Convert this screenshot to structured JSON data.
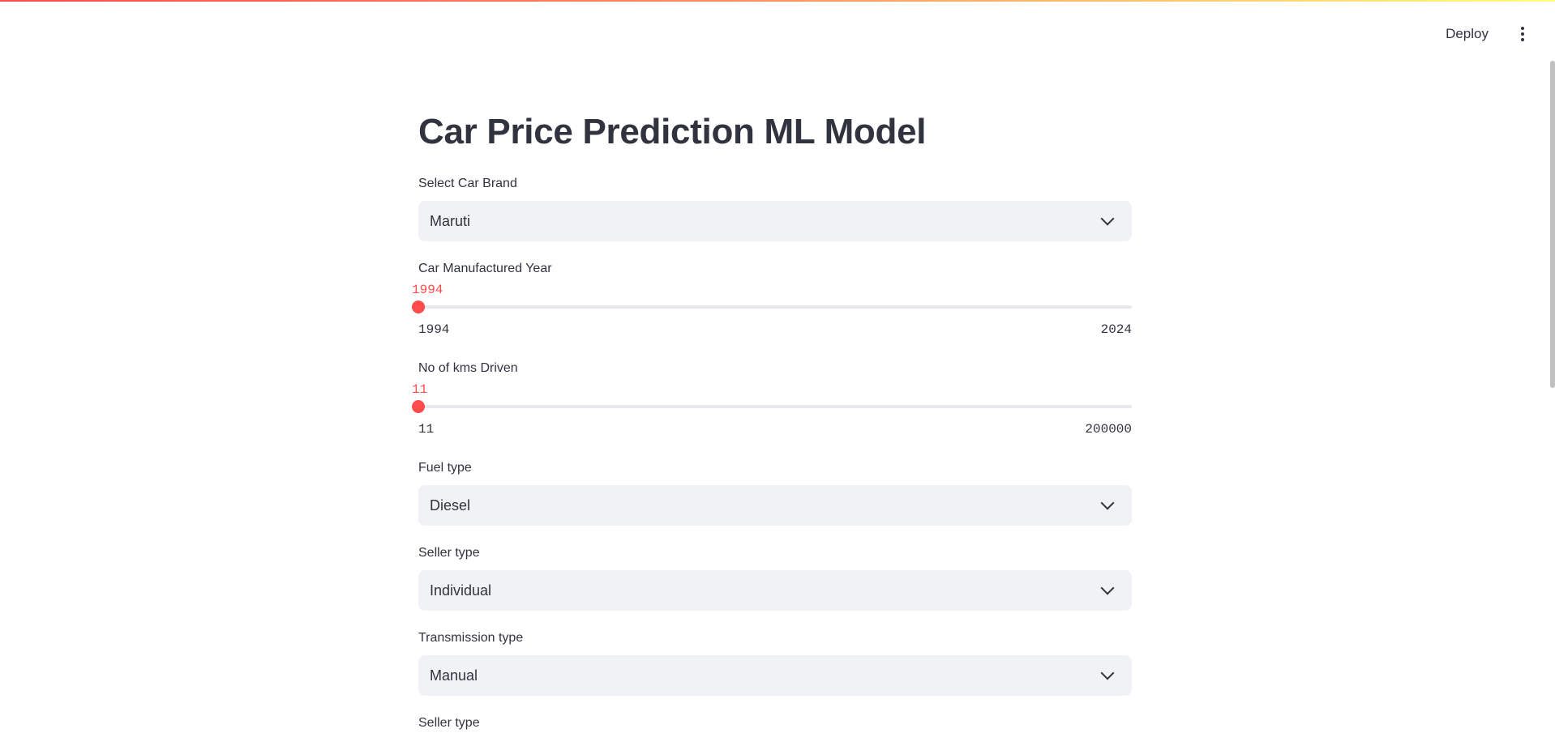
{
  "header": {
    "deploy_label": "Deploy",
    "menu_icon": "vertical-ellipsis-icon"
  },
  "main": {
    "title": "Car Price Prediction ML Model",
    "brand": {
      "label": "Select Car Brand",
      "value": "Maruti"
    },
    "year": {
      "label": "Car Manufactured Year",
      "value": "1994",
      "min": "1994",
      "max": "2024",
      "position": 0
    },
    "kms": {
      "label": "No of kms Driven",
      "value": "11",
      "min": "11",
      "max": "200000",
      "position": 0
    },
    "fuel": {
      "label": "Fuel type",
      "value": "Diesel"
    },
    "seller": {
      "label": "Seller type",
      "value": "Individual"
    },
    "transmission": {
      "label": "Transmission type",
      "value": "Manual"
    },
    "seller2": {
      "label": "Seller type"
    }
  },
  "colors": {
    "accent": "#ff4b4b",
    "select_bg": "#f0f2f6",
    "text": "#31333f"
  }
}
